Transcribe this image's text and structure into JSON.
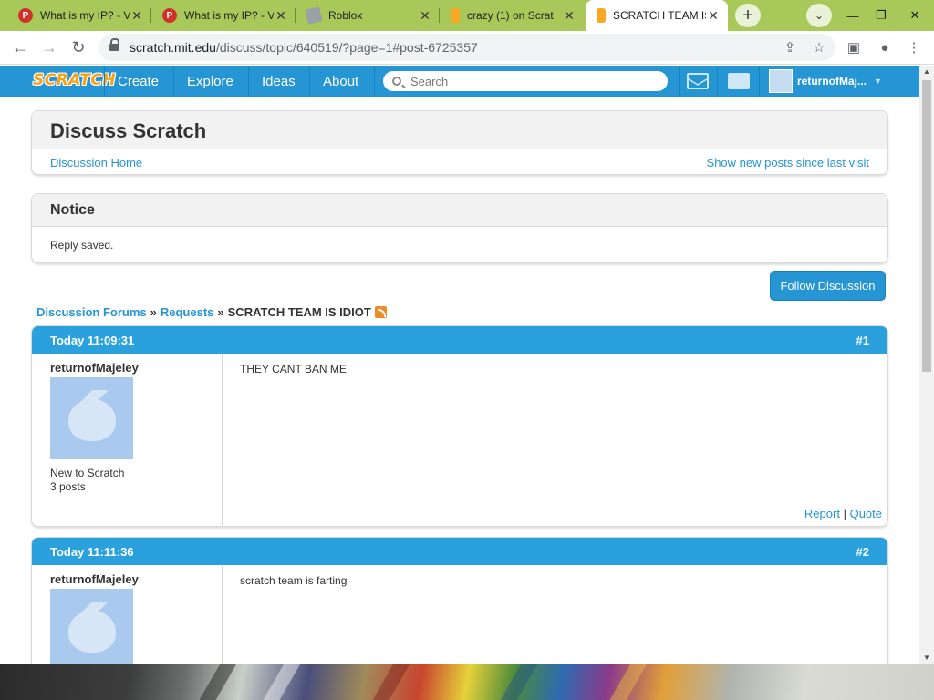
{
  "browser": {
    "tabs": [
      {
        "title": "What is my IP? - V",
        "favicon": "pinterest-icon",
        "active": false
      },
      {
        "title": "What is my IP? - V",
        "favicon": "pinterest-icon",
        "active": false
      },
      {
        "title": "Roblox",
        "favicon": "roblox-icon",
        "active": false
      },
      {
        "title": "crazy (1) on Scrat",
        "favicon": "scratch-icon",
        "active": false
      },
      {
        "title": "SCRATCH TEAM IS",
        "favicon": "scratch-icon",
        "active": true
      }
    ],
    "url_main": "scratch.mit.edu",
    "url_rest": "/discuss/topic/640519/?page=1#post-6725357",
    "colors": {
      "tabstrip": "#a8c85a",
      "accent": "#2595d4"
    }
  },
  "scratch_nav": {
    "logo": "SCRATCH",
    "links": [
      "Create",
      "Explore",
      "Ideas",
      "About"
    ],
    "search_placeholder": "Search",
    "username": "returnofMaj..."
  },
  "discuss_box": {
    "title": "Discuss Scratch",
    "home_link": "Discussion Home",
    "new_posts_link": "Show new posts since last visit"
  },
  "notice": {
    "title": "Notice",
    "message": "Reply saved."
  },
  "follow_button": "Follow Discussion",
  "breadcrumb": {
    "forums": "Discussion Forums",
    "sep": "»",
    "category": "Requests",
    "topic": "SCRATCH TEAM IS IDIOT"
  },
  "posts": [
    {
      "time": "Today 11:09:31",
      "number": "#1",
      "author": "returnofMajeley",
      "rank": "New to Scratch",
      "post_count": "3 posts",
      "body": "THEY CANT BAN ME",
      "report": "Report",
      "sep": "|",
      "quote": "Quote"
    },
    {
      "time": "Today 11:11:36",
      "number": "#2",
      "author": "returnofMajeley",
      "body": "scratch team is farting"
    }
  ]
}
